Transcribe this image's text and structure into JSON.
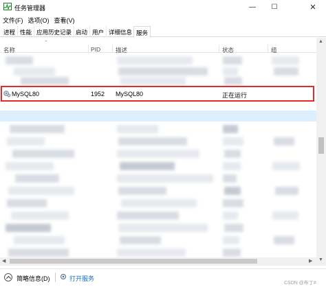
{
  "window": {
    "title": "任务管理器",
    "minimize_glyph": "—",
    "maximize_glyph": "☐",
    "close_glyph": "✕"
  },
  "menu": [
    "文件(F)",
    "选项(O)",
    "查看(V)"
  ],
  "tabs": [
    "进程",
    "性能",
    "应用历史记录",
    "启动",
    "用户",
    "详细信息",
    "服务"
  ],
  "active_tab": "服务",
  "columns": {
    "name": "名称",
    "pid": "PID",
    "description": "描述",
    "status": "状态",
    "group": "组"
  },
  "selected_service": {
    "name": "MySQL80",
    "pid": "1952",
    "description": "MySQL80",
    "status": "正在运行",
    "group": ""
  },
  "status_bar": {
    "less_details": "简略信息(D)",
    "open_services": "打开服务"
  },
  "watermark": "CSDN @布丁#",
  "colors": {
    "highlight_box": "#e4292b",
    "link": "#1a6fc4",
    "selection": "#cce8ff"
  },
  "icons": {
    "app": "task-manager-icon",
    "service": "service-gear-icon",
    "less": "chevron-up-circle-icon",
    "open": "services-icon"
  }
}
